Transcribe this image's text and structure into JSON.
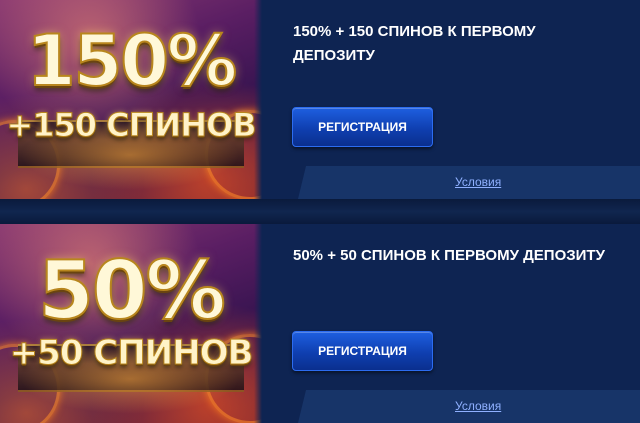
{
  "offers": [
    {
      "banner_big": "150%",
      "banner_sub": "+150 СПИНОВ",
      "title": "150% + 150 СПИНОВ К ПЕРВОМУ ДЕПОЗИТУ",
      "register_label": "РЕГИСТРАЦИЯ",
      "terms_label": "Условия"
    },
    {
      "banner_big": "50%",
      "banner_sub": "+50 СПИНОВ",
      "title": "50% + 50 СПИНОВ К ПЕРВОМУ ДЕПОЗИТУ",
      "register_label": "РЕГИСТРАЦИЯ",
      "terms_label": "Условия"
    }
  ],
  "colors": {
    "card_bg": "#0e2452",
    "button": "#1553d0",
    "link": "#8fb0ff",
    "banner_text": "#fff3c8"
  }
}
